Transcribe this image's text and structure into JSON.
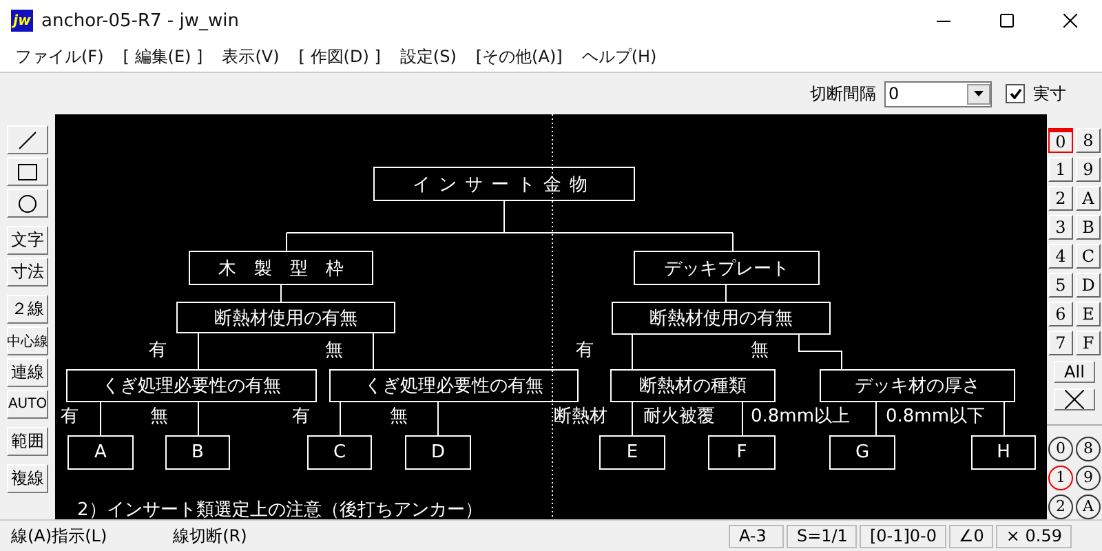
{
  "window": {
    "title": "anchor-05-R7 - jw_win",
    "app_icon_text": "jw"
  },
  "menu": [
    "ファイル(F)",
    "[ 編集(E) ]",
    "表示(V)",
    "[ 作図(D) ]",
    "設定(S)",
    "[その他(A)]",
    "ヘルプ(H)"
  ],
  "toolbar": {
    "label": "切断間隔",
    "value": "0",
    "checkbox": {
      "label": "実寸",
      "checked": true
    }
  },
  "tools": [
    {
      "kind": "line"
    },
    {
      "kind": "rect"
    },
    {
      "kind": "circle"
    },
    {
      "kind": "text",
      "label": "文字"
    },
    {
      "kind": "text",
      "label": "寸法"
    },
    {
      "kind": "text",
      "label": "２線"
    },
    {
      "kind": "text",
      "label": "中心線"
    },
    {
      "kind": "text",
      "label": "連線"
    },
    {
      "kind": "text",
      "label": "AUTO"
    },
    {
      "kind": "text",
      "label": "範囲"
    },
    {
      "kind": "text",
      "label": "複線"
    }
  ],
  "diagram": {
    "boxes": [
      "インサート金物",
      "木　製　型　枠",
      "デッキプレート",
      "断熱材使用の有無",
      "断熱材使用の有無",
      "くぎ処理必要性の有無",
      "くぎ処理必要性の有無",
      "断熱材の種類",
      "デッキ材の厚さ",
      "A",
      "B",
      "C",
      "D",
      "E",
      "F",
      "G",
      "H"
    ],
    "branch_labels": [
      "有",
      "無",
      "有",
      "無",
      "有",
      "無",
      "有",
      "無",
      "断熱材",
      "耐火被覆",
      "0.8mm以上",
      "0.8mm以下"
    ],
    "note": "2）インサート類選定上の注意（後打ちアンカー）"
  },
  "layers": [
    {
      "label": "0",
      "selected": true
    },
    {
      "label": "8",
      "selected": false
    },
    {
      "label": "1",
      "selected": false
    },
    {
      "label": "9",
      "selected": false
    },
    {
      "label": "2",
      "selected": false
    },
    {
      "label": "A",
      "selected": false
    },
    {
      "label": "3",
      "selected": false
    },
    {
      "label": "B",
      "selected": false
    },
    {
      "label": "4",
      "selected": false
    },
    {
      "label": "C",
      "selected": false
    },
    {
      "label": "5",
      "selected": false
    },
    {
      "label": "D",
      "selected": false
    },
    {
      "label": "6",
      "selected": false
    },
    {
      "label": "E",
      "selected": false
    },
    {
      "label": "7",
      "selected": false
    },
    {
      "label": "F",
      "selected": false
    }
  ],
  "layer_all": "All",
  "groups": [
    {
      "label": "0",
      "selected": false
    },
    {
      "label": "8",
      "selected": false
    },
    {
      "label": "1",
      "selected": true
    },
    {
      "label": "9",
      "selected": false
    },
    {
      "label": "2",
      "selected": false
    },
    {
      "label": "A",
      "selected": false
    }
  ],
  "status_bar": {
    "left": [
      "線(A)指示(L)",
      "線切断(R)"
    ],
    "cells": [
      "A-3",
      "S=1/1",
      "[0-1]0-0",
      "∠0",
      "× 0.59"
    ]
  }
}
